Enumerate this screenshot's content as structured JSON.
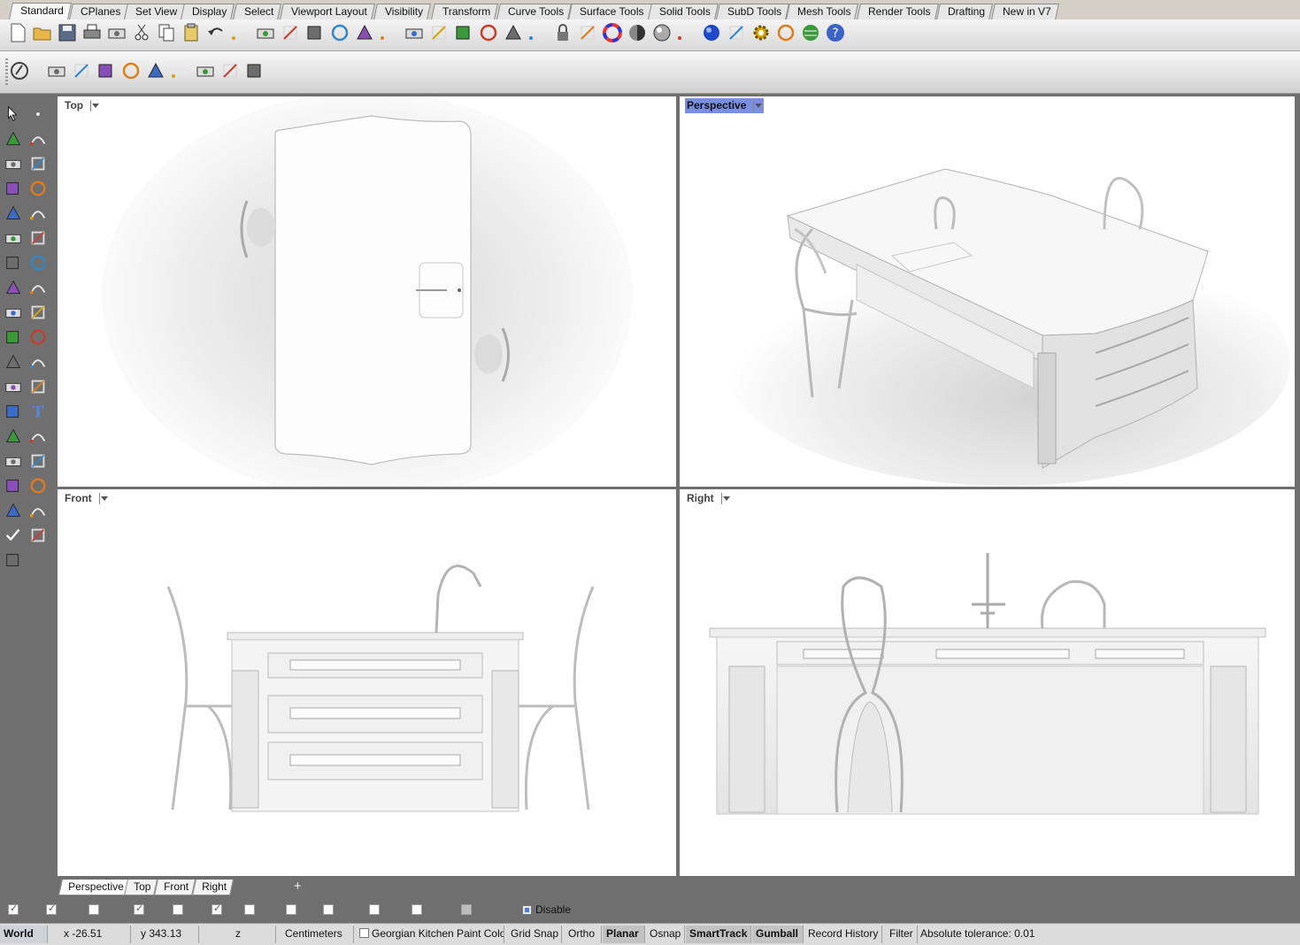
{
  "tabs": {
    "active": "Standard",
    "items": [
      "Standard",
      "CPlanes",
      "Set View",
      "Display",
      "Select",
      "Viewport Layout",
      "Visibility",
      "Transform",
      "Curve Tools",
      "Surface Tools",
      "Solid Tools",
      "SubD Tools",
      "Mesh Tools",
      "Render Tools",
      "Drafting",
      "New in V7"
    ]
  },
  "toolbar_main": [
    "new-file-icon",
    "open-file-icon",
    "save-icon",
    "print-icon",
    "import-icon",
    "cut-icon",
    "copy-icon",
    "paste-icon",
    "undo-icon",
    "pan-hand-icon",
    "rotate-view-icon",
    "zoom-dynamic-icon",
    "zoom-window-icon",
    "zoom-extents-icon",
    "zoom-selected-icon",
    "undo-view-icon",
    "four-viewports-icon",
    "car-options-icon",
    "select-all-icon",
    "circle-icon",
    "lights-icon",
    "light-bulb-icon",
    "lock-icon",
    "layers-icon",
    "color-wheel-icon",
    "shaded-sphere-icon",
    "rendered-sphere-icon",
    "material-sphere-icon",
    "blue-sphere-icon",
    "snap-icon",
    "gear-options-icon",
    "dimension-icon",
    "rhino-globe-icon",
    "help-icon"
  ],
  "toolbar_secondary": [
    "rhino-logo-icon",
    "teapot-icon",
    "render-window-icon",
    "render-preview-icon",
    "ground-plane-icon",
    "environment-box-icon",
    "sun-icon",
    "grass-icon",
    "decal-icon",
    "gumball-icon"
  ],
  "left_tools": [
    "select-arrow-icon",
    "point-icon",
    "polyline-icon",
    "curve-cp-icon",
    "circle-tool-icon",
    "ellipse-icon",
    "polygon-icon",
    "rectangle-icon",
    "arc-icon",
    "fillet-curve-icon",
    "surface-cp-icon",
    "extrude-icon",
    "box-solid-icon",
    "boolean-union-icon",
    "cylinder-icon",
    "mesh-icon",
    "explode-icon",
    "lightning-icon",
    "trim-icon",
    "split-icon",
    "group-icon",
    "ungroup-icon",
    "layer-props-icon",
    "offset-icon",
    "move-icon",
    "text-icon",
    "array-icon",
    "scale-icon",
    "dimension-tool-icon",
    "block-icon",
    "gridline-icon",
    "array-grid-icon",
    "history-icon",
    "clipping-icon",
    "check-icon",
    "solid-tools-icon",
    "paint-icon"
  ],
  "viewports": {
    "top": {
      "label": "Top"
    },
    "perspective": {
      "label": "Perspective"
    },
    "front": {
      "label": "Front"
    },
    "right": {
      "label": "Right"
    }
  },
  "viewport_tabs": {
    "items": [
      "Perspective",
      "Top",
      "Front",
      "Right"
    ],
    "active": "Perspective",
    "add": "+"
  },
  "osnap": {
    "checkboxes": [
      true,
      true,
      false,
      true,
      false,
      true,
      false,
      false,
      false,
      false,
      false,
      false
    ],
    "disable_label": "Disable"
  },
  "statusbar": {
    "cplane": "World",
    "x": "x -26.51",
    "y": "y 343.13",
    "z": "z",
    "units": "Centimeters",
    "layer": "Georgian Kitchen Paint Colo",
    "grid_snap": "Grid Snap",
    "ortho": "Ortho",
    "planar": "Planar",
    "osnap": "Osnap",
    "smarttrack": "SmartTrack",
    "gumball": "Gumball",
    "record_history": "Record History",
    "filter": "Filter",
    "tolerance": "Absolute tolerance: 0.01"
  },
  "colors": {
    "active_viewport_title": "#7b8fe0",
    "background": "#6f6f6f",
    "viewport_bg": "#ffffff"
  }
}
